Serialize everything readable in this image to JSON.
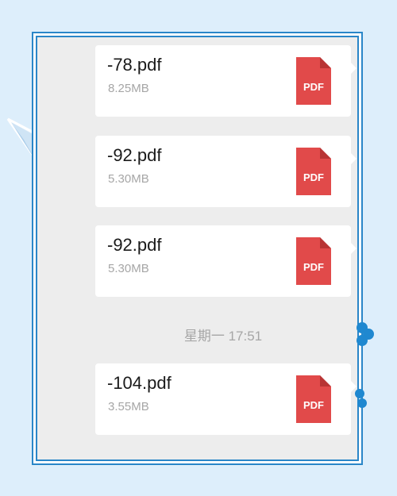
{
  "colors": {
    "background": "#ddeefb",
    "frame_border": "#2a86c8",
    "chat_background": "#ededed",
    "bubble": "#ffffff",
    "pdf_icon": "#e14a4a",
    "secondary_text": "#a6a6a6"
  },
  "messages": [
    {
      "name": "-78.pdf",
      "size": "8.25MB",
      "icon": "pdf-file-icon",
      "icon_label": "PDF"
    },
    {
      "name": "-92.pdf",
      "size": "5.30MB",
      "icon": "pdf-file-icon",
      "icon_label": "PDF"
    },
    {
      "name": "-92.pdf",
      "size": "5.30MB",
      "icon": "pdf-file-icon",
      "icon_label": "PDF"
    },
    {
      "name": "-104.pdf",
      "size": "3.55MB",
      "icon": "pdf-file-icon",
      "icon_label": "PDF"
    }
  ],
  "timestamp": "星期一 17:51"
}
